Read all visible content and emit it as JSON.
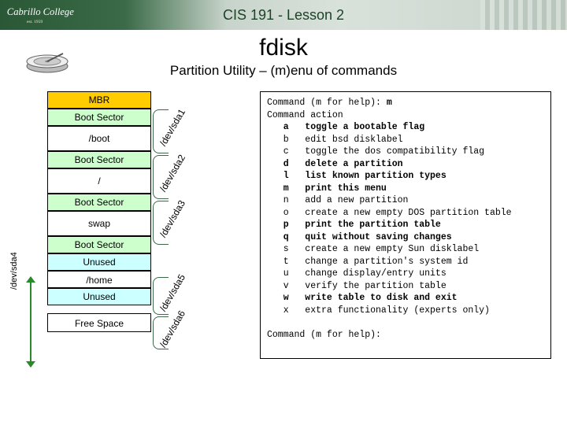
{
  "header": {
    "course_title": "CIS 191 - Lesson 2",
    "logo_text": "Cabrillo College",
    "logo_sub": "est. 1959"
  },
  "page": {
    "title": "fdisk",
    "subtitle": "Partition Utility – (m)enu of commands"
  },
  "disk": {
    "mbr": "MBR",
    "boot_sector": "Boot Sector",
    "boot": "/boot",
    "root": "/",
    "swap": "swap",
    "unused": "Unused",
    "home": "/home",
    "free": "Free Space",
    "ext_label": "/dev/sda4",
    "dev1": "/dev/sda1",
    "dev2": "/dev/sda2",
    "dev3": "/dev/sda3",
    "dev5": "/dev/sda5",
    "dev6": "/dev/sda6"
  },
  "term": {
    "line1": "Command (m for help): ",
    "cmd": "m",
    "line2": "Command action",
    "a": "   a   toggle a bootable flag",
    "b": "   b   edit bsd disklabel",
    "c": "   c   toggle the dos compatibility flag",
    "d": "   d   delete a partition",
    "l": "   l   list known partition types",
    "m": "   m   print this menu",
    "n": "   n   add a new partition",
    "o": "   o   create a new empty DOS partition table",
    "p": "   p   print the partition table",
    "q": "   q   quit without saving changes",
    "s": "   s   create a new empty Sun disklabel",
    "t": "   t   change a partition's system id",
    "u": "   u   change display/entry units",
    "v": "   v   verify the partition table",
    "w": "   w   write table to disk and exit",
    "x": "   x   extra functionality (experts only)",
    "prompt2": "Command (m for help): "
  }
}
